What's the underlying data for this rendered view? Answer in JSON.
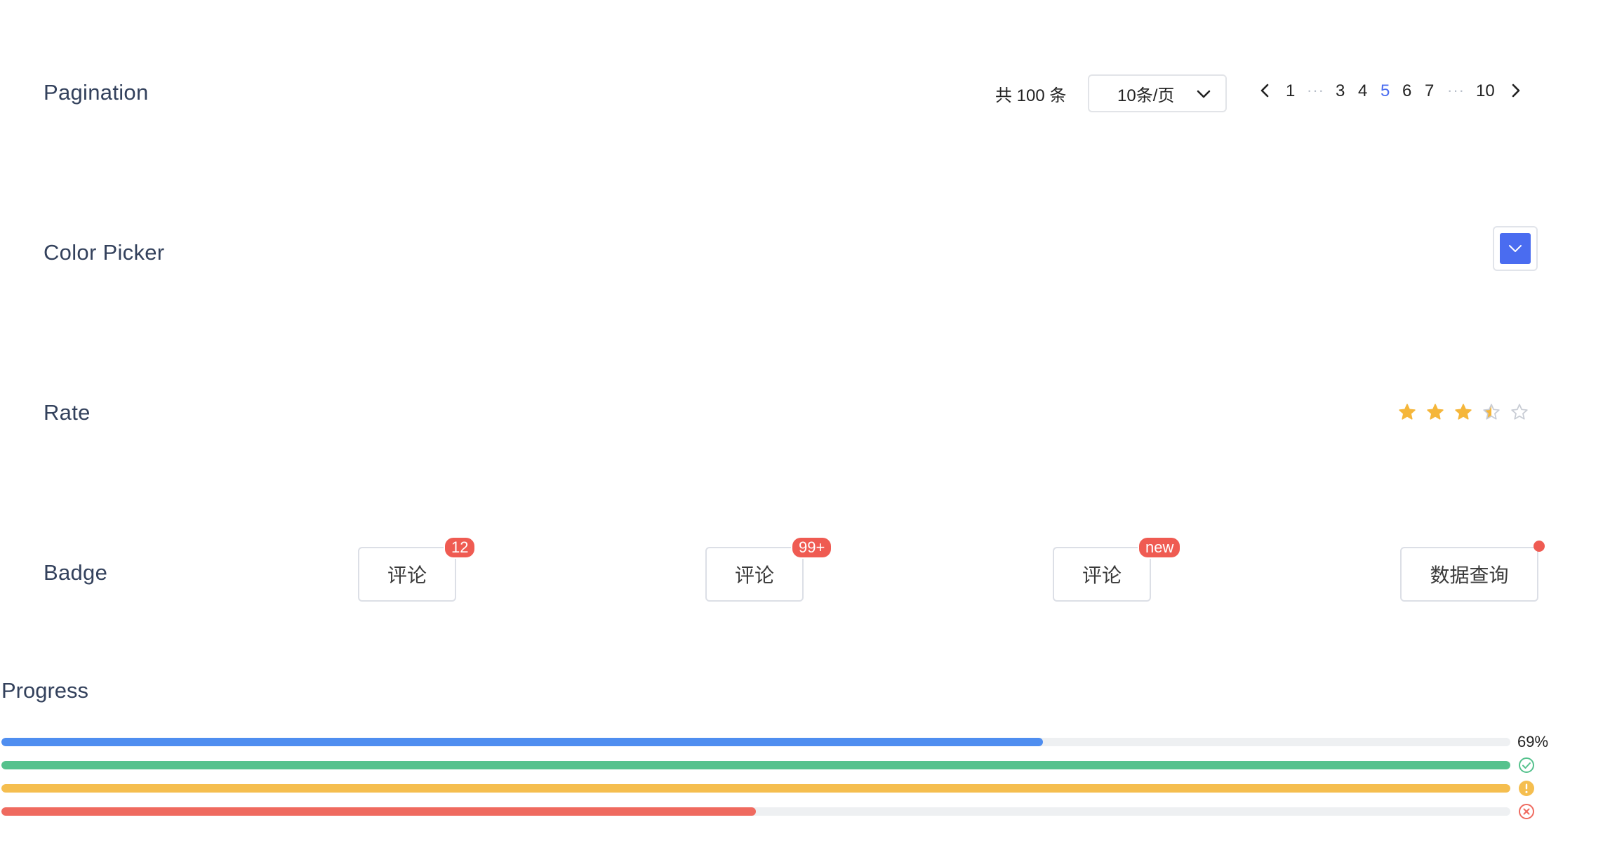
{
  "sections": {
    "pagination": "Pagination",
    "color_picker": "Color Picker",
    "rate": "Rate",
    "badge": "Badge",
    "progress": "Progress"
  },
  "pagination": {
    "total": "共 100 条",
    "page_size": "10条/页",
    "pages": [
      "1",
      "3",
      "4",
      "5",
      "6",
      "7",
      "10"
    ],
    "ellipsis": "···",
    "current": "5"
  },
  "color_picker": {
    "value": "#4a6cf0"
  },
  "rate": {
    "value": 3.5,
    "max": 5,
    "color": "#f5b63a",
    "empty_color": "#c8ccd4"
  },
  "badges": [
    {
      "label": "评论",
      "count": "12"
    },
    {
      "label": "评论",
      "count": "99+"
    },
    {
      "label": "评论",
      "count": "new"
    },
    {
      "label": "数据查询",
      "dot": true
    }
  ],
  "progress": [
    {
      "percent": 69,
      "color": "#4f8ef0",
      "text": "69%"
    },
    {
      "percent": 100,
      "color": "#55c28d",
      "status": "success-icon"
    },
    {
      "percent": 100,
      "color": "#f5be4f",
      "status": "warning-icon"
    },
    {
      "percent": 50,
      "color": "#ef6a5f",
      "status": "error-icon"
    }
  ],
  "colors": {
    "accent": "#4a6cf0",
    "badge": "#ef5b52"
  }
}
